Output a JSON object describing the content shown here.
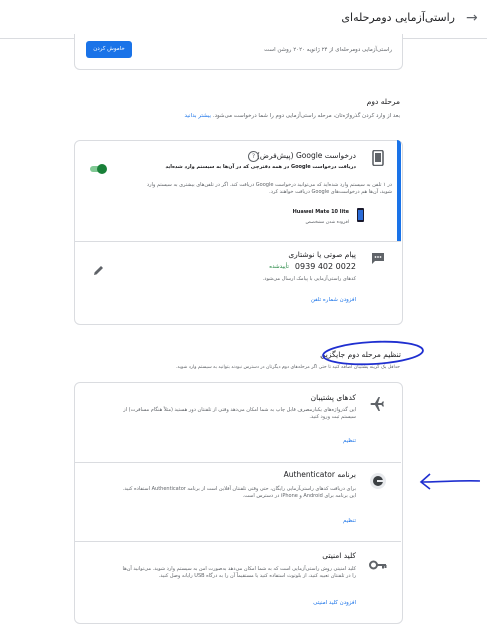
{
  "header": {
    "title": "راستی‌آزمایی دومرحله‌ای"
  },
  "status_card": {
    "description": "راستی‌آزمایی دومرحله‌ای از ۲۴ ژانویه ۲۰۲۰ روشن است",
    "disable_button": "خاموش کردن"
  },
  "second_step": {
    "heading": "مرحله دوم",
    "description": "بعد از وارد کردن گذرواژه‌تان، مرحله راستی‌آزمایی دوم را شما درخواست می‌شود.",
    "learn_more": "بیشتر بدانید"
  },
  "google_prompt": {
    "title": "درخواست Google (پیش‌فرض)",
    "help_icon": "question-circle-icon",
    "subtitle": "دریافت درخواست Google در همه دفترچی که در آن‌ها به سیستم وارد شده‌اید",
    "desc_line1": "در ۱ تلفن به سیستم وارد شده‌اید که می‌توانید درخواست Google دریافت کند. اگر در تلفن‌های بیشتری به سیستم وارد",
    "desc_line2": "شوید، آن‌ها هم درخواست‌های Google دریافت خواهند کرد.",
    "device_name": "Huawei Mate 10 lite",
    "device_note": "افزوده شدن مشخصص",
    "toggle_on": true
  },
  "sms": {
    "title": "پیام صوتی یا نوشتاری",
    "phone": "0939 402 0022",
    "verified": "تأییدشده",
    "description": "کدهای راستی‌آزمایی با پیامک ارسال می‌شود.",
    "add_link": "افزودن شماره تلفن"
  },
  "alt_section": {
    "heading": "تنظیم مرحله دوم جایگزین",
    "description": "حداقل یک گزینه پشتیبان اضافه کنید تا حتی اگر مرحله‌های دوم دیگرتان در دسترس نبودند بتوانید به سیستم وارد شوید."
  },
  "backup_codes": {
    "title": "کدهای پشتیبان",
    "desc_line1": "این گذرواژه‌های یکبارمصرف قابل چاپ به شما امکان می‌دهد وقتی از تلفنتان دور هستید (مثلاً هنگام مسافرت) از",
    "desc_line2": "سیستم ثبت ورود کنید.",
    "action": "تنظیم"
  },
  "authenticator": {
    "title": "برنامه Authenticator",
    "desc_line1": "برای دریافت کدهای راستی‌آزمایی رایگان، حتی وقتی تلفنتان آفلاین است از برنامه Authenticator استفاده کنید.",
    "desc_line2": "این برنامه برای Android و iPhone در دسترس است.",
    "action": "تنظیم"
  },
  "security_key": {
    "title": "کلید امنیتی",
    "desc_line1": "کلید امنیتی روش راستی‌آزمایی است که به شما امکان می‌دهد به‌صورت امن به سیستم وارد شوید. می‌توانید آن‌ها",
    "desc_line2": "را در تلفنتان تعبیه کنید، از بلوتوث استفاده کنید یا مستقیماً آن را به درگاه USB رایانه وصل کنید.",
    "action": "افزودن کلید امنیتی"
  },
  "colors": {
    "accent": "#1a73e8",
    "toggle": "#188038",
    "annotation": "#1f2fd0"
  }
}
